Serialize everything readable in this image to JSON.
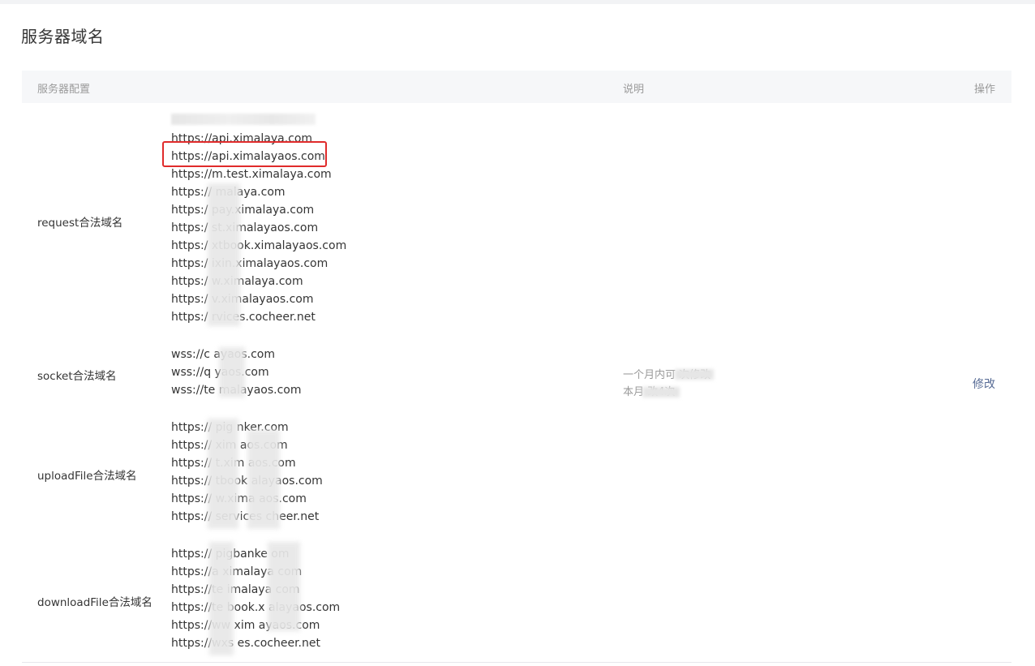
{
  "page": {
    "title": "服务器域名"
  },
  "table": {
    "headers": {
      "config": "服务器配置",
      "description": "说明",
      "operation": "操作"
    }
  },
  "sections": {
    "request": {
      "label": "request合法域名",
      "domains": [
        "https://api.ximalaya.com",
        "https://api.ximalayaos.com",
        "https://m.test.ximalaya.com",
        "https://  malaya.com",
        "https:/  pay.ximalaya.com",
        "https:/  st.ximalayaos.com",
        "https:/  xtbook.ximalayaos.com",
        "https:/  ixin.ximalayaos.com",
        "https:/  w.ximalaya.com",
        "https:/  v.ximalayaos.com",
        "https:/  rvices.cocheer.net"
      ]
    },
    "socket": {
      "label": "socket合法域名",
      "domains": [
        "wss://c  ayaos.com",
        "wss://q  yaos.com",
        "wss://te  malayaos.com"
      ]
    },
    "uploadFile": {
      "label": "uploadFile合法域名",
      "domains": [
        "https://  pig  nker.com",
        "https://  xim  aos.com",
        "https://  t.xim  aos.com",
        "https://  tbook  alayaos.com",
        "https://  w.xima  aos.com",
        "https://  services  cheer.net"
      ]
    },
    "downloadFile": {
      "label": "downloadFile合法域名",
      "domains": [
        "https://  pigbanke  om",
        "https://a  ximalaya  com",
        "https://te  imalaya  com",
        "https://te  book.x  alayaos.com",
        "https://ww  xim  ayaos.com",
        "https://wxs  es.cocheer.net"
      ]
    }
  },
  "description": {
    "line1": "一个月内可  次修改",
    "line2": "本月  改4次"
  },
  "operation": {
    "modify_label": "修改"
  },
  "colors": {
    "highlight": "#e02b2b",
    "link": "#576b95",
    "header_bg": "#f6f7f9"
  }
}
